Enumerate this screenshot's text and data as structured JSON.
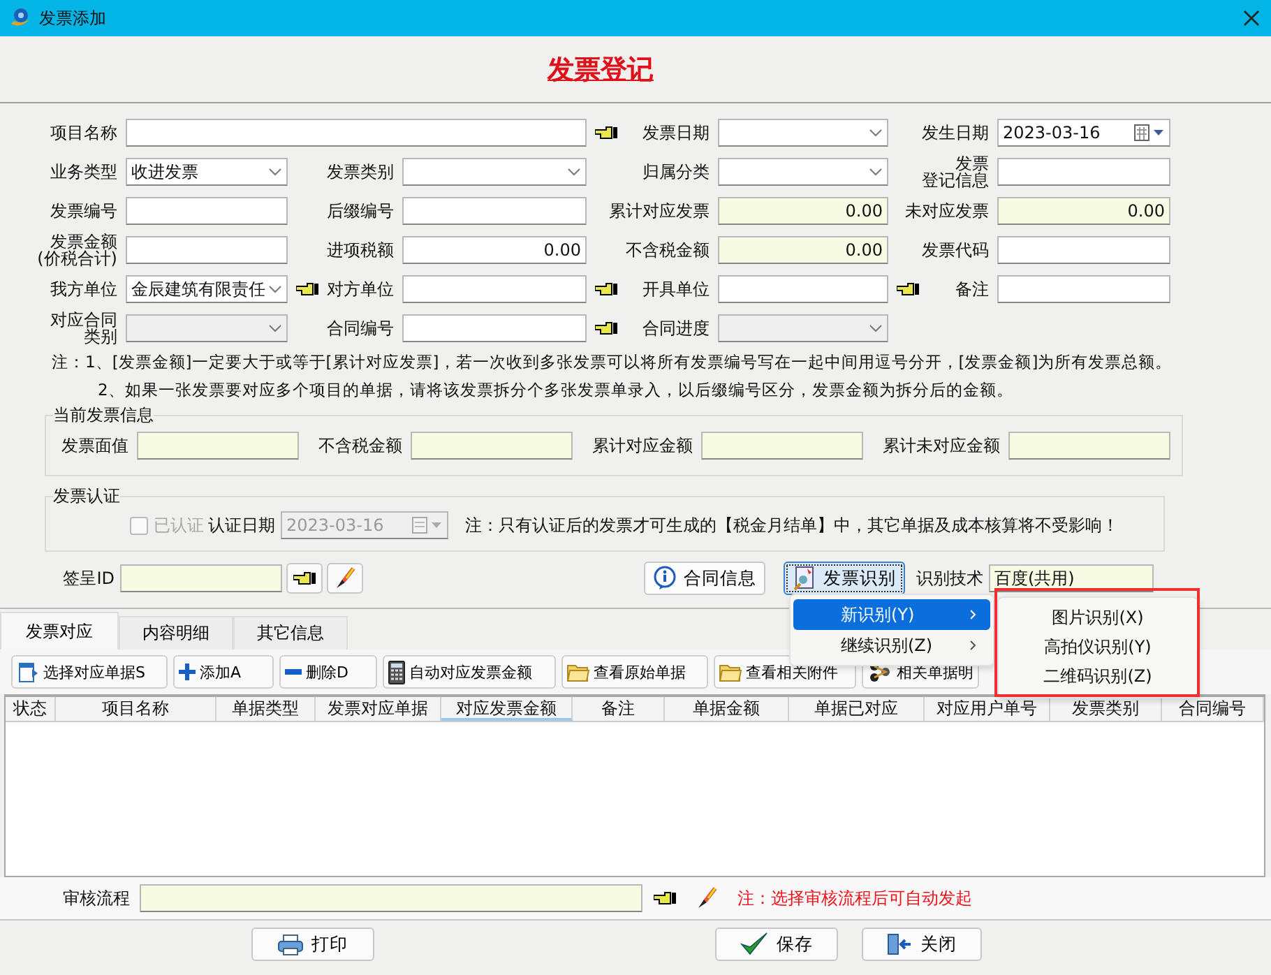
{
  "window": {
    "title": "发票添加"
  },
  "heading": "发票登记",
  "form": {
    "rows": [
      [
        {
          "label": "项目名称",
          "kind": "text",
          "readonly": false,
          "disabled": false,
          "lookup": true
        },
        "",
        {
          "label": "发票日期",
          "kind": "combo",
          "readonly": false,
          "disabled": false,
          "lookup": false
        },
        {
          "label": "发生日期",
          "kind": "date",
          "value": "2023-03-16",
          "readonly": false,
          "disabled": false,
          "lookup": false
        }
      ],
      [
        {
          "label": "业务类型",
          "kind": "combo",
          "value": "收进发票",
          "readonly": false,
          "disabled": false,
          "lookup": false
        },
        {
          "label": "发票类别",
          "kind": "combo",
          "readonly": false,
          "disabled": false,
          "lookup": false
        },
        {
          "label": "归属分类",
          "kind": "combo",
          "readonly": false,
          "disabled": false,
          "lookup": false
        },
        {
          "label": [
            "发票",
            "登记信息"
          ],
          "kind": "text",
          "readonly": false,
          "disabled": false,
          "lookup": false
        }
      ],
      [
        {
          "label": "发票编号",
          "kind": "text",
          "readonly": false,
          "disabled": false,
          "lookup": false
        },
        {
          "label": "后缀编号",
          "kind": "text",
          "readonly": false,
          "disabled": false,
          "lookup": false
        },
        {
          "label": "累计对应发票",
          "kind": "number",
          "value": "0.00",
          "readonly": true,
          "disabled": false,
          "lookup": false
        },
        {
          "label": "未对应发票",
          "kind": "number",
          "value": "0.00",
          "readonly": true,
          "disabled": false,
          "lookup": false
        }
      ],
      [
        {
          "label": [
            "发票金额",
            "(价税合计)"
          ],
          "kind": "text",
          "readonly": false,
          "disabled": false,
          "lookup": false
        },
        {
          "label": "进项税额",
          "kind": "number",
          "value": "0.00",
          "readonly": false,
          "disabled": false,
          "lookup": false
        },
        {
          "label": "不含税金额",
          "kind": "number",
          "value": "0.00",
          "readonly": true,
          "disabled": false,
          "lookup": false
        },
        {
          "label": "发票代码",
          "kind": "text",
          "readonly": false,
          "disabled": false,
          "lookup": false
        }
      ],
      [
        {
          "label": "我方单位",
          "kind": "combo",
          "value": "金辰建筑有限责任",
          "readonly": false,
          "disabled": false,
          "lookup": true
        },
        {
          "label": "对方单位",
          "kind": "text",
          "readonly": false,
          "disabled": false,
          "lookup": true
        },
        {
          "label": "开具单位",
          "kind": "text",
          "readonly": false,
          "disabled": false,
          "lookup": true
        },
        {
          "label": "备注",
          "kind": "text",
          "readonly": false,
          "disabled": false,
          "lookup": false
        }
      ],
      [
        {
          "label": [
            "对应合同",
            "类别"
          ],
          "kind": "combo",
          "readonly": false,
          "disabled": true,
          "lookup": false
        },
        {
          "label": "合同编号",
          "kind": "text",
          "readonly": false,
          "disabled": false,
          "lookup": true
        },
        {
          "label": "合同进度",
          "kind": "combo",
          "readonly": false,
          "disabled": true,
          "lookup": false
        }
      ]
    ]
  },
  "notes": [
    "注：1、[发票金额]一定要大于或等于[累计对应发票]，若一次收到多张发票可以将所有发票编号写在一起中间用逗号分开，[发票金额]为所有发票总额。",
    "2、如果一张发票要对应多个项目的单据，请将该发票拆分个多张发票单录入，以后缀编号区分，发票金额为拆分后的金额。"
  ],
  "current_invoice": {
    "title": "当前发票信息",
    "fields": [
      {
        "label": "发票面值",
        "readonly": true
      },
      {
        "label": "不含税金额",
        "readonly": true
      },
      {
        "label": "累计对应金额",
        "readonly": true
      },
      {
        "label": "累计未对应金额",
        "readonly": true
      }
    ]
  },
  "certification": {
    "title": "发票认证",
    "checkbox": {
      "label": "已认证",
      "checked": false,
      "disabled": true
    },
    "date_label": "认证日期",
    "date": {
      "value": "2023-03-16",
      "disabled": true
    },
    "note": "注：只有认证后的发票才可生成的【税金月结单】中，其它单据及成本核算将不受影响！"
  },
  "sign": {
    "label": "签呈ID",
    "readonly": true
  },
  "buttons_mid": [
    {
      "label": "合同信息",
      "kind": "info",
      "pressed": false
    },
    {
      "label": "发票识别",
      "kind": "scan",
      "pressed": true
    }
  ],
  "recognition": {
    "label": "识别技术",
    "value": "百度(共用)",
    "readonly": true
  },
  "menu": {
    "items": [
      {
        "label": "新识别(Y)",
        "selected": true
      },
      {
        "label": "继续识别(Z)",
        "selected": false
      }
    ],
    "submenu": [
      {
        "label": "图片识别(X)"
      },
      {
        "label": "高拍仪识别(Y)"
      },
      {
        "label": "二维码识别(Z)"
      }
    ]
  },
  "tabs": [
    {
      "label": "发票对应",
      "selected": true
    },
    {
      "label": "内容明细",
      "selected": false
    },
    {
      "label": "其它信息",
      "selected": false
    }
  ],
  "toolbar": [
    {
      "label": "选择对应单据S",
      "kind": "note"
    },
    {
      "label": "添加A",
      "kind": "plus"
    },
    {
      "label": "删除D",
      "kind": "minus"
    },
    {
      "label": "自动对应发票金额",
      "kind": "calc"
    },
    {
      "label": "查看原始单据",
      "kind": "folder"
    },
    {
      "label": "查看相关附件",
      "kind": "folder"
    },
    {
      "label": "相关单据明",
      "kind": "tree"
    }
  ],
  "table": {
    "columns": [
      {
        "label": "状态",
        "sorted": false
      },
      {
        "label": "项目名称",
        "sorted": false
      },
      {
        "label": "单据类型",
        "sorted": false
      },
      {
        "label": "发票对应单据",
        "sorted": false
      },
      {
        "label": "对应发票金额",
        "sorted": true
      },
      {
        "label": "备注",
        "sorted": false
      },
      {
        "label": "单据金额",
        "sorted": false
      },
      {
        "label": "单据已对应",
        "sorted": false
      },
      {
        "label": "对应用户单号",
        "sorted": false
      },
      {
        "label": "发票类别",
        "sorted": false
      },
      {
        "label": "合同编号",
        "sorted": false
      }
    ]
  },
  "approval": {
    "label": "审核流程",
    "readonly": true,
    "note": "注：选择审核流程后可自动发起"
  },
  "footer_buttons": [
    {
      "label": "打印",
      "kind": "print"
    },
    {
      "label": "保存",
      "kind": "save"
    },
    {
      "label": "关闭",
      "kind": "close"
    }
  ]
}
